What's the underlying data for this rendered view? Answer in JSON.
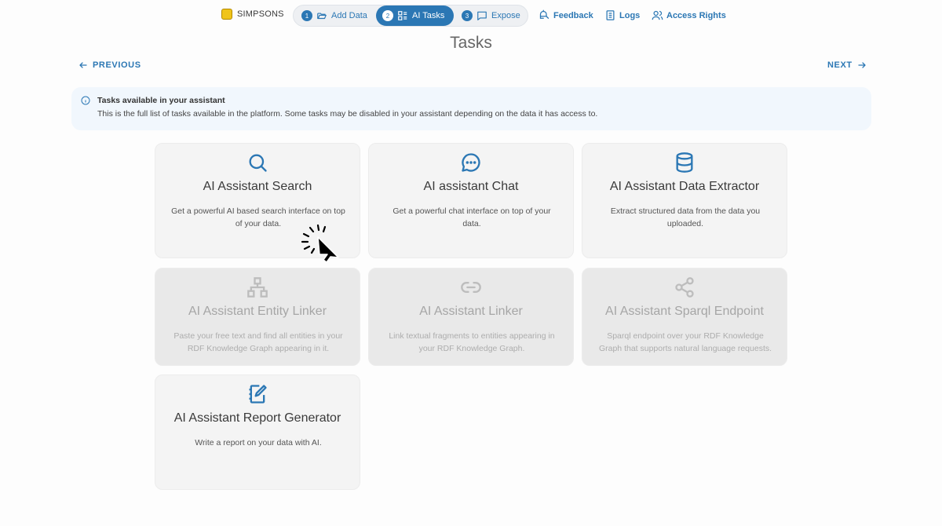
{
  "brand": {
    "name": "SIMPSONS"
  },
  "steps": [
    {
      "num": "1",
      "label": "Add Data",
      "icon": "folder-open-icon"
    },
    {
      "num": "2",
      "label": "AI Tasks",
      "icon": "grid-list-icon",
      "active": true
    },
    {
      "num": "3",
      "label": "Expose",
      "icon": "chat-square-icon"
    }
  ],
  "nav": {
    "feedback": "Feedback",
    "logs": "Logs",
    "access": "Access Rights"
  },
  "page_title": "Tasks",
  "pager": {
    "previous": "PREVIOUS",
    "next": "NEXT"
  },
  "info": {
    "heading": "Tasks available in your assistant",
    "text": "This is the full list of tasks available in the platform. Some tasks may be disabled in your assistant depending on the data it has access to."
  },
  "tasks": [
    {
      "title": "AI Assistant Search",
      "description": "Get a powerful AI based search interface on top of your data.",
      "icon": "search-icon",
      "disabled": false
    },
    {
      "title": "AI assistant Chat",
      "description": "Get a powerful chat interface on top of your data.",
      "icon": "chat-bubble-icon",
      "disabled": false
    },
    {
      "title": "AI Assistant Data Extractor",
      "description": "Extract structured data from the data you uploaded.",
      "icon": "database-icon",
      "disabled": false
    },
    {
      "title": "AI Assistant Entity Linker",
      "description": "Paste your free text and find all entities in your RDF Knowledge Graph appearing in it.",
      "icon": "hierarchy-icon",
      "disabled": true
    },
    {
      "title": "AI Assistant Linker",
      "description": "Link textual fragments to entities appearing in your RDF Knowledge Graph.",
      "icon": "link-icon",
      "disabled": true
    },
    {
      "title": "AI Assistant Sparql Endpoint",
      "description": "Sparql endpoint over your RDF Knowledge Graph that supports natural language requests.",
      "icon": "share-icon",
      "disabled": true
    },
    {
      "title": "AI Assistant Report Generator",
      "description": "Write a report on your data with AI.",
      "icon": "notebook-edit-icon",
      "disabled": false
    }
  ],
  "colors": {
    "accent": "#2b77b4",
    "disabled_icon": "#bdbdbd"
  }
}
